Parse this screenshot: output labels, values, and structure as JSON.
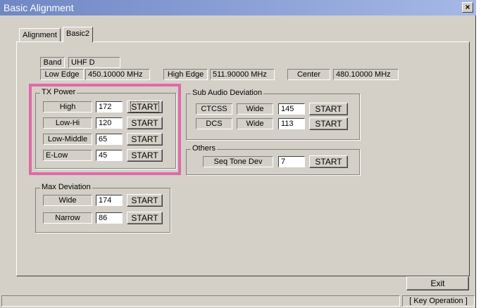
{
  "window": {
    "title": "Basic Alignment",
    "close_label": "×"
  },
  "tabs": [
    {
      "label": "Alignment"
    },
    {
      "label": "Basic2"
    }
  ],
  "band": {
    "label": "Band",
    "value": "UHF D"
  },
  "edges": {
    "low_label": "Low Edge",
    "low_value": "450.10000 MHz",
    "high_label": "High Edge",
    "high_value": "511.90000 MHz",
    "center_label": "Center",
    "center_value": "480.10000 MHz"
  },
  "tx_power": {
    "title": "TX Power",
    "rows": [
      {
        "label": "High",
        "value": "172",
        "button": "START"
      },
      {
        "label": "Low-Hi",
        "value": "120",
        "button": "START"
      },
      {
        "label": "Low-Middle",
        "value": "65",
        "button": "START"
      },
      {
        "label": "E-Low",
        "value": "45",
        "button": "START"
      }
    ]
  },
  "sub_audio": {
    "title": "Sub Audio Deviation",
    "rows": [
      {
        "label": "CTCSS",
        "mode": "Wide",
        "value": "145",
        "button": "START"
      },
      {
        "label": "DCS",
        "mode": "Wide",
        "value": "113",
        "button": "START"
      }
    ]
  },
  "others": {
    "title": "Others",
    "rows": [
      {
        "label": "Seq Tone Dev",
        "value": "7",
        "button": "START"
      }
    ]
  },
  "max_deviation": {
    "title": "Max Deviation",
    "rows": [
      {
        "label": "Wide",
        "value": "174",
        "button": "START"
      },
      {
        "label": "Narrow",
        "value": "86",
        "button": "START"
      }
    ]
  },
  "footer": {
    "exit_label": "Exit",
    "status_text": "[ Key Operation ]"
  }
}
